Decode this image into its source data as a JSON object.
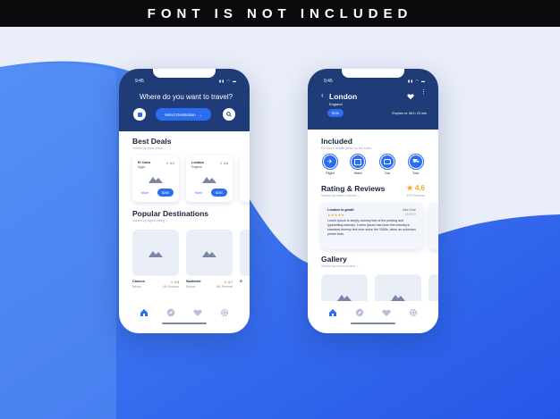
{
  "banner": {
    "text": "FONT IS NOT INCLUDED"
  },
  "colors": {
    "primary": "#2c6df0",
    "navy": "#1f3b78",
    "star": "#f5a623",
    "bg_light": "#e9eef9"
  },
  "left_phone": {
    "status_time": "9:45",
    "header_title": "Where do you want to travel?",
    "select_label": "Select Destination",
    "best_deals": {
      "title": "Best Deals",
      "subtitle": "Sorted by lower price",
      "cards": [
        {
          "city": "El Cairo",
          "country": "Egypt",
          "rating": "4.2",
          "more_label": "More",
          "price": "$260"
        },
        {
          "city": "London",
          "country": "England",
          "rating": "4.6",
          "more_label": "More",
          "price": "$260"
        }
      ]
    },
    "popular": {
      "title": "Popular Destinations",
      "subtitle": "Sorted by higher rating",
      "cards": [
        {
          "city": "Cancun",
          "country": "Mexico",
          "rating": "4.5",
          "reviews": "436 Reviews"
        },
        {
          "city": "Santorini",
          "country": "Greece",
          "rating": "4.7",
          "reviews": "463 Reviews"
        },
        {
          "city": "G",
          "country": "",
          "rating": "",
          "reviews": ""
        }
      ]
    },
    "tabs": [
      "home-icon",
      "compass-icon",
      "heart-icon",
      "gear-icon"
    ]
  },
  "right_phone": {
    "status_time": "9:45",
    "city": "London",
    "country": "England",
    "price": "$330",
    "expires": "Expires in: 58 h 23 min",
    "included": {
      "title": "Included",
      "subtitle": "For more details press on the icons",
      "items": [
        {
          "icon": "plane-icon",
          "label": "Flight"
        },
        {
          "icon": "hotel-icon",
          "label": "Hotel"
        },
        {
          "icon": "car-icon",
          "label": "Car"
        },
        {
          "icon": "tour-icon",
          "label": "Tour"
        }
      ]
    },
    "rating": {
      "title": "Rating & Reviews",
      "subtitle": "Sorted by recent reviews",
      "score": "4.6",
      "reviews": "429 Reviews",
      "review": {
        "title": "London is great!",
        "author": "John Doe",
        "date": "12/08/19",
        "stars": "★★★★★",
        "body": "Lorem Ipsum is simply dummy text of the printing and typesetting industry. Lorem Ipsum has been the industry's standard dummy text ever since the 1500s, when an unknown printer took."
      }
    },
    "gallery": {
      "title": "Gallery",
      "subtitle": "Sorted by recent photos"
    },
    "tabs": [
      "home-icon",
      "compass-icon",
      "heart-icon",
      "gear-icon"
    ]
  }
}
